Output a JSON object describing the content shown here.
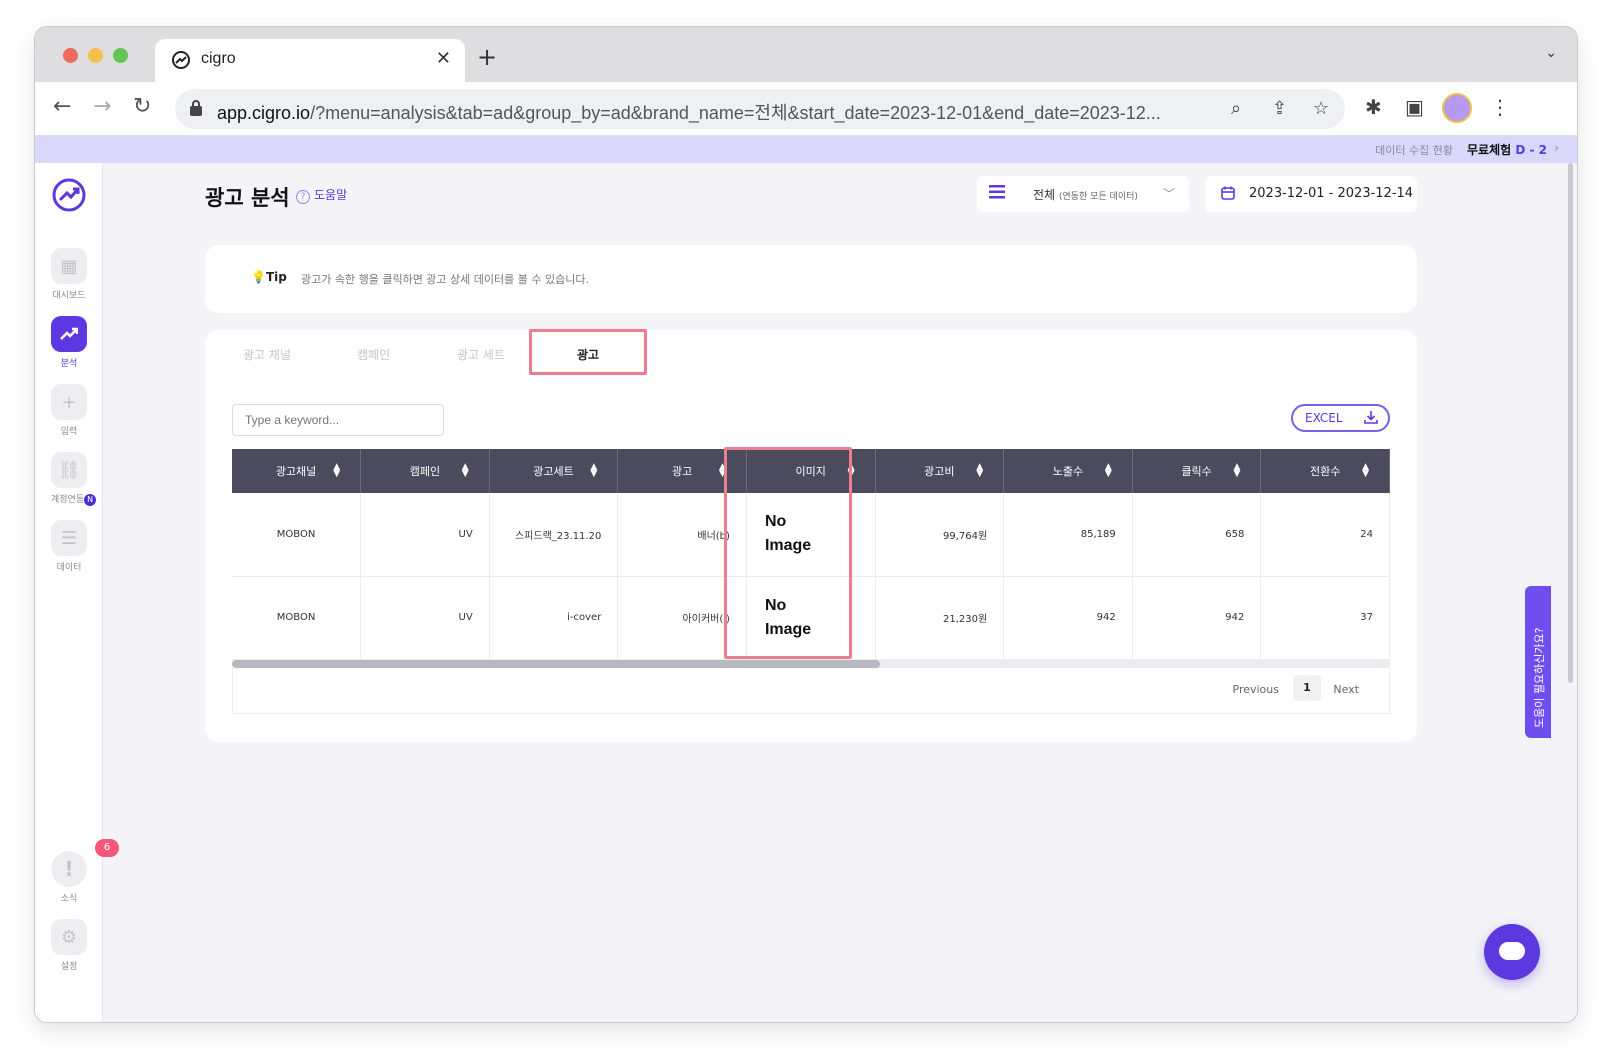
{
  "browser": {
    "tab_title": "cigro",
    "url_host": "app.cigro.io",
    "url_path": "/?menu=analysis&tab=ad&group_by=ad&brand_name=전체&start_date=2023-12-01&end_date=2023-12..."
  },
  "banner": {
    "status": "데이터 수집 현황",
    "trial_label": "무료체험",
    "trial_days": "D - 2"
  },
  "sidebar": {
    "items": [
      {
        "label": "대시보드",
        "icon": "grid-icon"
      },
      {
        "label": "분석",
        "icon": "trend-icon"
      },
      {
        "label": "입력",
        "icon": "plus-icon"
      },
      {
        "label": "계정연동",
        "icon": "link-icon",
        "badge": "N"
      },
      {
        "label": "데이터",
        "icon": "database-icon"
      },
      {
        "label": "소식",
        "icon": "alert-icon",
        "count": "6"
      },
      {
        "label": "설정",
        "icon": "gear-icon"
      }
    ]
  },
  "header": {
    "title": "광고 분석",
    "help": "도움말",
    "brand_value": "전체",
    "brand_sub": "(연동한 모든 데이터)",
    "date_range": "2023-12-01 - 2023-12-14"
  },
  "tip": {
    "label": "Tip",
    "text": "광고가 속한 행을 클릭하면 광고 상세 데이터를 볼 수 있습니다."
  },
  "subtabs": [
    "광고 채널",
    "캠페인",
    "광고 세트",
    "광고"
  ],
  "search": {
    "placeholder": "Type a keyword..."
  },
  "excel_label": "EXCEL",
  "table": {
    "columns": [
      "광고채널",
      "캠페인",
      "광고세트",
      "광고",
      "이미지",
      "광고비",
      "노출수",
      "클릭수",
      "전환수"
    ],
    "rows": [
      {
        "channel": "MOBON",
        "campaign": "UV",
        "adset": "스피드랙_23.11.20",
        "ad": "배너(b)",
        "image_line1": "No",
        "image_line2": "Image",
        "spend": "99,764원",
        "impressions": "85,189",
        "clicks": "658",
        "conversions": "24"
      },
      {
        "channel": "MOBON",
        "campaign": "UV",
        "adset": "i-cover",
        "ad": "아이커버(i)",
        "image_line1": "No",
        "image_line2": "Image",
        "spend": "21,230원",
        "impressions": "942",
        "clicks": "942",
        "conversions": "37"
      }
    ]
  },
  "pager": {
    "prev": "Previous",
    "page": "1",
    "next": "Next"
  },
  "help_tab": "도움이 필요하신가요?",
  "colors": {
    "accent": "#5b38e0",
    "header_bg": "#4c4b5e",
    "highlight": "#e8808f",
    "banner": "#d9d8fb"
  }
}
